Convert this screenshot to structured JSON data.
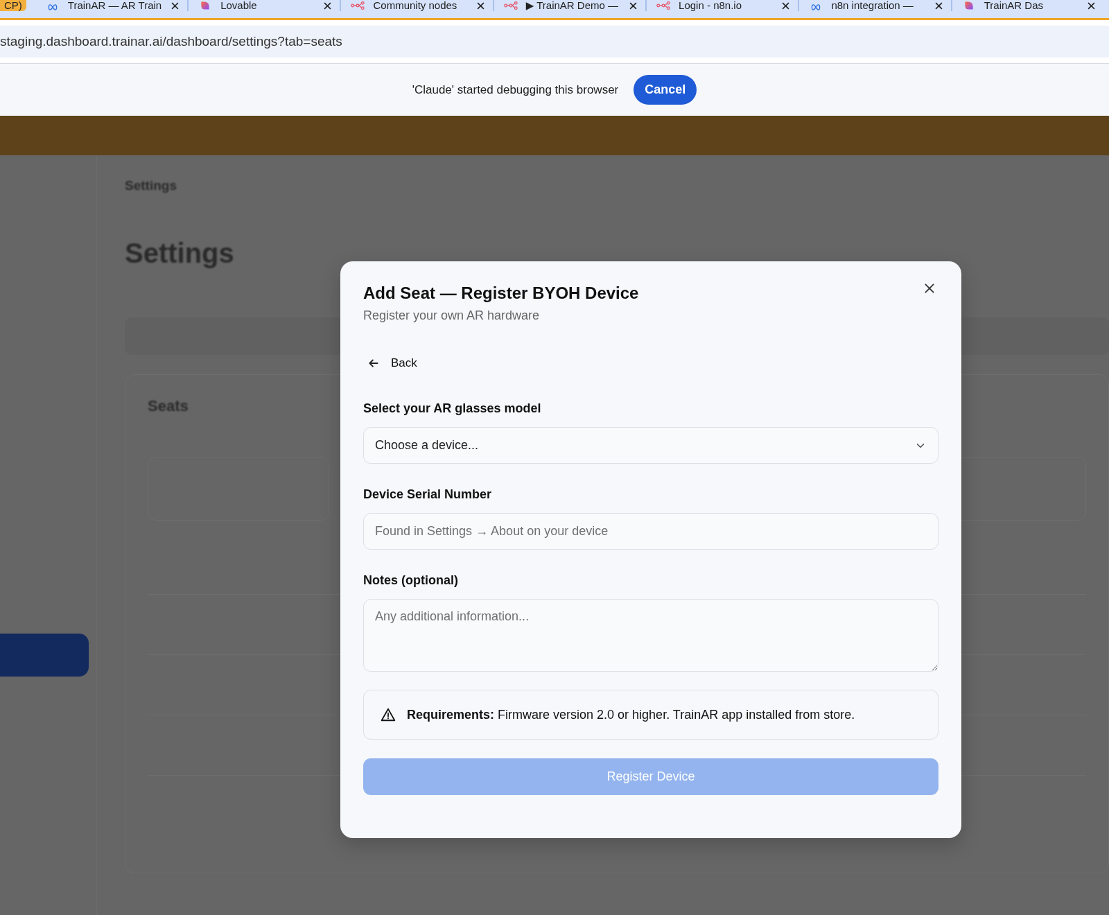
{
  "browser": {
    "tabs": [
      {
        "title": "CP)",
        "kind": "group"
      },
      {
        "title": "TrainAR — AR Train",
        "kind": "meta"
      },
      {
        "title": "Lovable",
        "kind": "lovable"
      },
      {
        "title": "Community nodes",
        "kind": "n8n"
      },
      {
        "title": "▶ TrainAR Demo —",
        "kind": "n8n"
      },
      {
        "title": "Login - n8n.io",
        "kind": "n8n"
      },
      {
        "title": "n8n integration —",
        "kind": "meta"
      },
      {
        "title": "TrainAR Das",
        "kind": "lovable"
      }
    ],
    "address": "staging.dashboard.trainar.ai/dashboard/settings?tab=seats"
  },
  "debug_banner": {
    "message": "'Claude' started debugging this browser",
    "button": "Cancel"
  },
  "background": {
    "breadcrumb": "Settings",
    "heading": "Settings",
    "section": "Seats"
  },
  "dialog": {
    "title": "Add Seat — Register BYOH Device",
    "subtitle": "Register your own AR hardware",
    "back": "Back",
    "fields": [
      {
        "kind": "select",
        "label": "Select your AR glasses model",
        "placeholder": "Choose a device..."
      },
      {
        "kind": "text",
        "label": "Device Serial Number",
        "placeholder": "Found in Settings → About on your device"
      },
      {
        "kind": "textarea",
        "label": "Notes (optional)",
        "placeholder": "Any additional information..."
      }
    ],
    "notice": "**Requirements:** Firmware version 2.0 or higher. TrainAR app installed from store.",
    "submit": {
      "label": "Register Device",
      "disabled": true
    }
  }
}
